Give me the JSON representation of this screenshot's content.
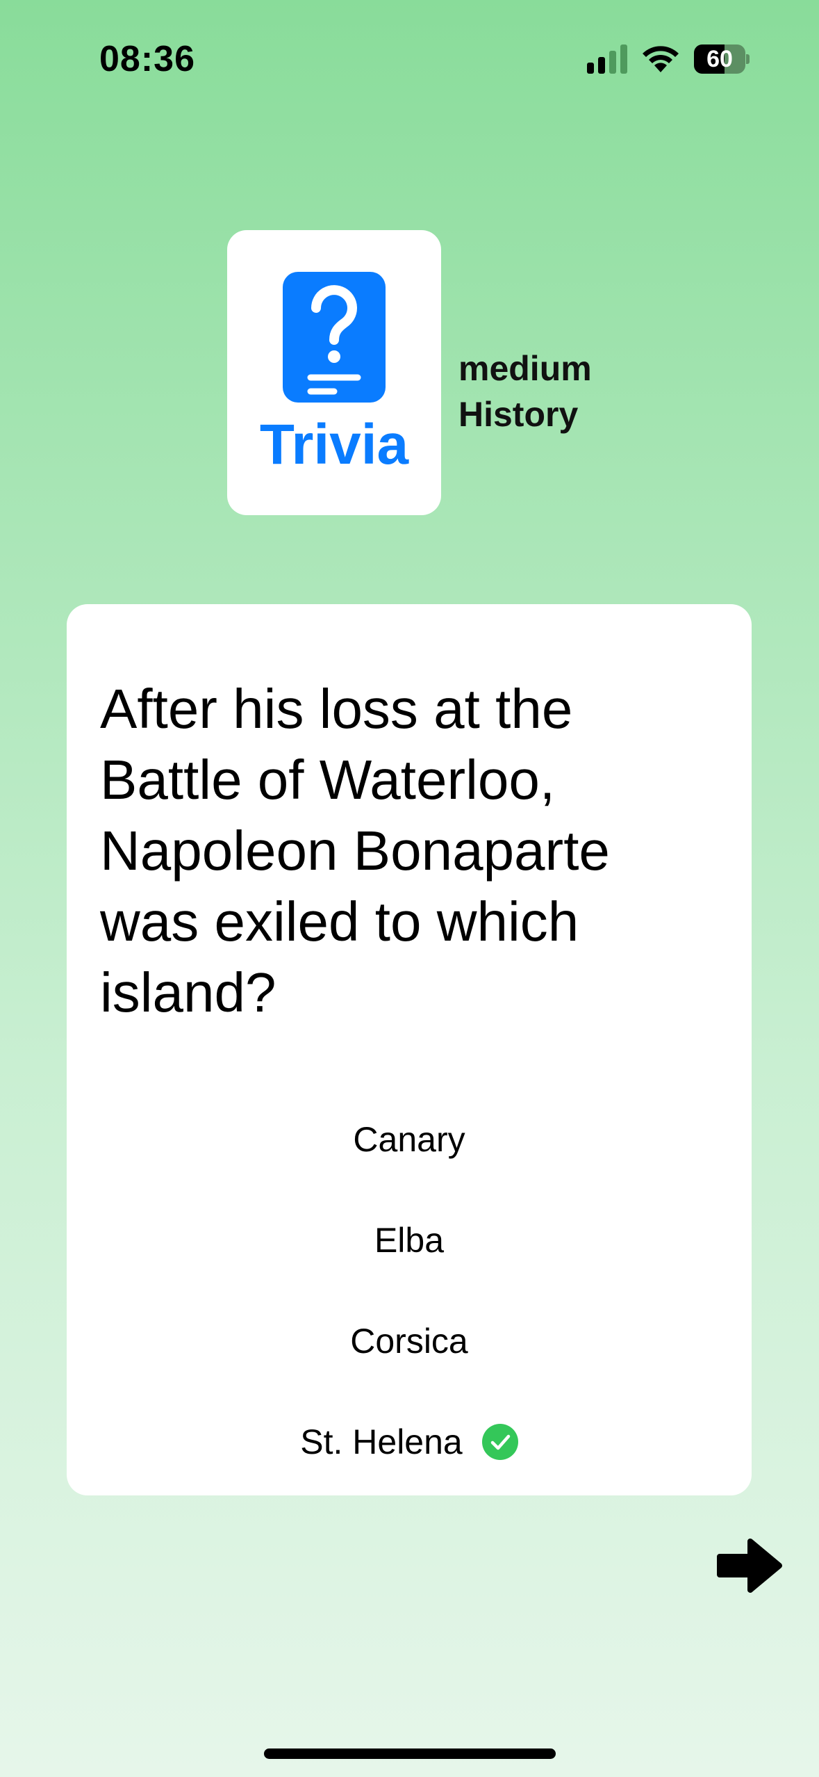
{
  "status_bar": {
    "time": "08:36",
    "battery_level": "60",
    "battery_fraction": 0.6
  },
  "header": {
    "app_name": "Trivia",
    "icon": "question-card-icon",
    "difficulty": "medium",
    "category": "History"
  },
  "question": {
    "text": "After his loss at the Battle of Waterloo, Napoleon Bonaparte was exiled to which island?",
    "answers": [
      {
        "label": "Canary",
        "correct": false
      },
      {
        "label": "Elba",
        "correct": false
      },
      {
        "label": "Corsica",
        "correct": false
      },
      {
        "label": "St. Helena",
        "correct": true
      }
    ]
  },
  "controls": {
    "next_icon": "arrow-right-icon"
  },
  "colors": {
    "accent": "#0a7cff",
    "correct": "#34c759",
    "background_top": "#89dc9a",
    "background_bottom": "#e6f6ea"
  }
}
